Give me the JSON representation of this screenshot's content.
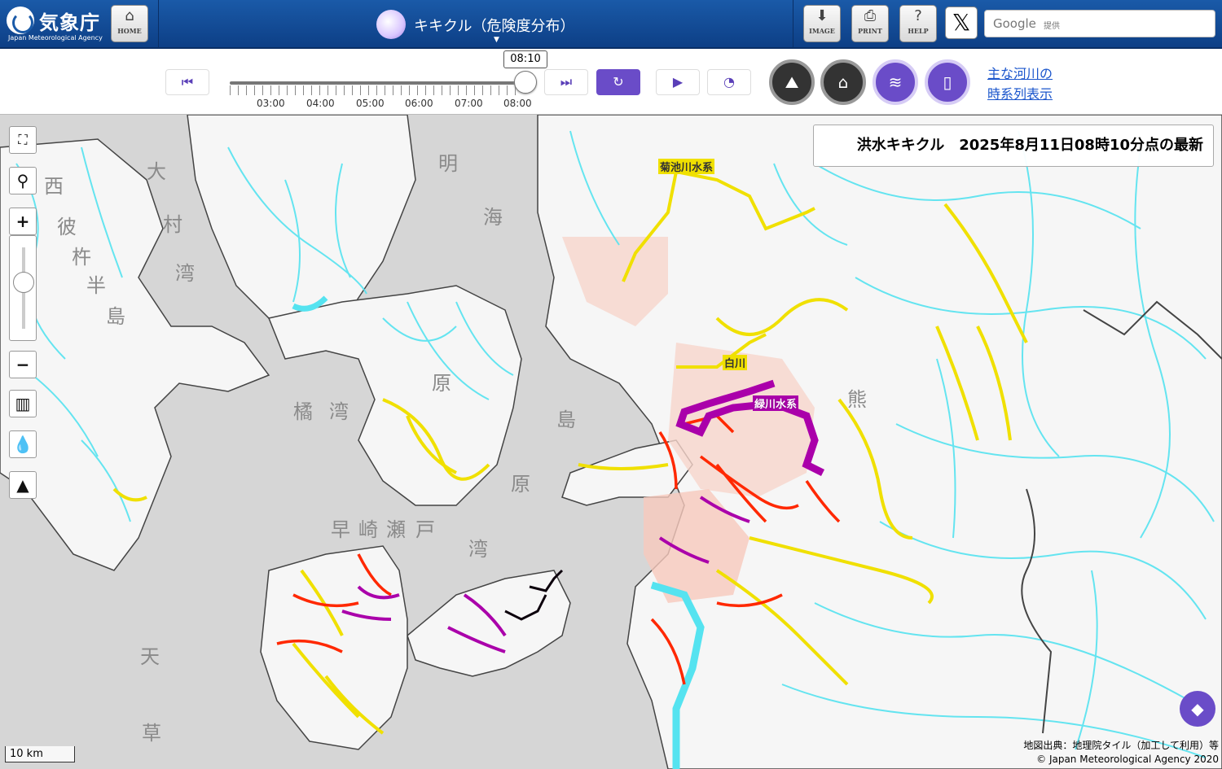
{
  "header": {
    "agency_name": "気象庁",
    "agency_name_en": "Japan Meteorological Agency",
    "home_label": "HOME",
    "title": "キキクル（危険度分布）",
    "image_label": "IMAGE",
    "print_label": "PRINT",
    "help_label": "HELP",
    "x_label": "𝕏",
    "search_brand": "Google",
    "search_sub": "提供"
  },
  "timeline": {
    "current_time": "08:10",
    "labels": [
      "03:00",
      "04:00",
      "05:00",
      "06:00",
      "07:00",
      "08:00"
    ],
    "position": 1.0
  },
  "toolbar": {
    "first_icon": "skip-back-icon",
    "last_icon": "skip-forward-icon",
    "refresh_icon": "refresh-icon",
    "play_icon": "play-icon",
    "speed_icon": "speed-icon",
    "layers": [
      "landslide-layer",
      "inundation-layer",
      "flood-layer",
      "map-layer"
    ],
    "rivers_link_line1": "主な河川の",
    "rivers_link_line2": "時系列表示"
  },
  "map": {
    "status": "洪水キキクル　2025年8月11日08時10分点の最新",
    "river_labels": [
      "菊池川水系",
      "白川",
      "緑川水系"
    ],
    "place_labels": [
      "明",
      "海",
      "大",
      "村",
      "湾",
      "西",
      "彼",
      "杵",
      "半",
      "島",
      "橘",
      "湾",
      "島",
      "原",
      "原",
      "早",
      "崎",
      "瀬",
      "戸",
      "湾",
      "天",
      "草",
      "熊"
    ],
    "scale": "10 km",
    "attribution_1": "地図出典：地理院タイル（加工して利用）等",
    "attribution_2": "© Japan Meteorological Agency 2020",
    "colors": {
      "water": "#d6d6d6",
      "land": "#f7f7f7",
      "river": "#55e3f0",
      "yellow": "#f0e000",
      "red": "#ff2800",
      "purple": "#aa00aa",
      "black": "#0c000c"
    }
  }
}
